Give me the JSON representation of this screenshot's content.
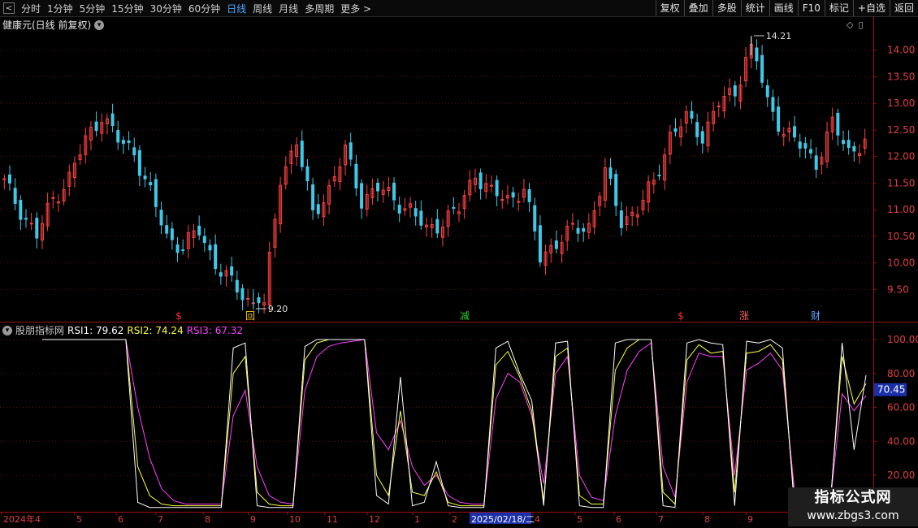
{
  "toolbar": {
    "back_glyph": "<",
    "periods": [
      "分时",
      "1分钟",
      "5分钟",
      "15分钟",
      "30分钟",
      "60分钟",
      "日线",
      "周线",
      "月线",
      "多周期",
      "更多 >"
    ],
    "active_period": "日线",
    "right_buttons": [
      "复权",
      "叠加",
      "多股",
      "统计",
      "画线",
      "F10",
      "标记",
      "+自选",
      "返回"
    ]
  },
  "main_panel": {
    "title": "健康元(日线 前复权)",
    "high_label": "14.21",
    "low_label": "9.20",
    "price_axis": [
      "14.00",
      "13.50",
      "13.00",
      "12.50",
      "12.00",
      "11.50",
      "11.00",
      "10.50",
      "10.00",
      "9.50"
    ],
    "event_markers": [
      {
        "glyph": "$",
        "color": "#ff3030"
      },
      {
        "glyph": "回",
        "color": "#ffcc00"
      },
      {
        "glyph": "减",
        "color": "#30d030"
      },
      {
        "glyph": "$",
        "color": "#ff3030"
      },
      {
        "glyph": "涨",
        "color": "#ff6060"
      },
      {
        "glyph": "财",
        "color": "#60a0ff"
      }
    ]
  },
  "indicator_panel": {
    "name": "股朋指标网",
    "rsi1": "RSI1: 79.62",
    "rsi2": "RSI2: 74.24",
    "rsi3": "RSI3: 67.32",
    "axis": [
      "100.00",
      "80.00",
      "60.00",
      "40.00",
      "20.00"
    ],
    "current_value": "70.45"
  },
  "date_axis": {
    "labels": [
      "2024年4",
      "5",
      "6",
      "7",
      "8",
      "9",
      "10",
      "11",
      "12",
      "1",
      "2",
      "2025/02/18/二",
      "4",
      "5",
      "6",
      "7",
      "8",
      "9"
    ],
    "highlight": "2025/02/18/二"
  },
  "watermark": {
    "line1": "指标公式网",
    "line2": "www.zbgs3.com"
  },
  "colors": {
    "up": "#ff4040",
    "down": "#40c8e8",
    "axis": "#a01010",
    "rsi1": "#ffffff",
    "rsi2": "#ffff40",
    "rsi3": "#ff40ff"
  },
  "chart_data": [
    {
      "type": "candlestick",
      "title": "健康元(日线 前复权)",
      "price_range": [
        9.2,
        14.21
      ],
      "close_trace": [
        [
          "2024-04",
          11.5
        ],
        [
          "2024-04",
          11.0
        ],
        [
          "2024-04",
          10.5
        ],
        [
          "2024-05",
          11.2
        ],
        [
          "2024-05",
          11.6
        ],
        [
          "2024-05",
          12.3
        ],
        [
          "2024-06",
          12.8
        ],
        [
          "2024-06",
          12.3
        ],
        [
          "2024-06",
          12.1
        ],
        [
          "2024-07",
          11.3
        ],
        [
          "2024-07",
          10.5
        ],
        [
          "2024-07",
          10.3
        ],
        [
          "2024-08",
          10.6
        ],
        [
          "2024-08",
          10.0
        ],
        [
          "2024-08",
          9.6
        ],
        [
          "2024-09",
          9.3
        ],
        [
          "2024-09",
          9.2
        ],
        [
          "2024-09",
          11.6
        ],
        [
          "2024-10",
          12.3
        ],
        [
          "2024-10",
          10.9
        ],
        [
          "2024-10",
          11.4
        ],
        [
          "2024-11",
          12.1
        ],
        [
          "2024-11",
          11.2
        ],
        [
          "2024-11",
          11.4
        ],
        [
          "2024-12",
          11.2
        ],
        [
          "2024-12",
          11.0
        ],
        [
          "2024-12",
          10.6
        ],
        [
          "2025-01",
          10.8
        ],
        [
          "2025-01",
          11.0
        ],
        [
          "2025-01",
          11.7
        ],
        [
          "2025-02",
          11.3
        ],
        [
          "2025-02",
          11.2
        ],
        [
          "2025-02",
          11.4
        ],
        [
          "2025-03",
          10.1
        ],
        [
          "2025-03",
          10.4
        ],
        [
          "2025-03",
          10.6
        ],
        [
          "2025-04",
          10.7
        ],
        [
          "2025-04",
          11.7
        ],
        [
          "2025-04",
          10.8
        ],
        [
          "2025-05",
          11.0
        ],
        [
          "2025-05",
          11.5
        ],
        [
          "2025-05",
          12.4
        ],
        [
          "2025-06",
          12.7
        ],
        [
          "2025-06",
          12.4
        ],
        [
          "2025-06",
          13.0
        ],
        [
          "2025-07",
          13.2
        ],
        [
          "2025-07",
          14.21
        ],
        [
          "2025-07",
          13.0
        ],
        [
          "2025-08",
          12.5
        ],
        [
          "2025-08",
          12.2
        ],
        [
          "2025-08",
          11.9
        ],
        [
          "2025-09",
          12.6
        ],
        [
          "2025-09",
          12.1
        ],
        [
          "2025-09",
          12.3
        ]
      ]
    },
    {
      "type": "line",
      "ylim": [
        20,
        100
      ],
      "series": [
        {
          "name": "RSI1",
          "color": "#ffffff",
          "values": [
            100,
            100,
            100,
            100,
            100,
            100,
            100,
            100,
            4,
            1,
            1,
            1,
            1,
            1,
            1,
            1,
            95,
            98,
            2,
            1,
            1,
            1,
            96,
            100,
            100,
            100,
            100,
            100,
            8,
            3,
            78,
            2,
            4,
            28,
            2,
            1,
            1,
            1,
            95,
            99,
            80,
            64,
            2,
            98,
            99,
            2,
            1,
            1,
            98,
            100,
            100,
            100,
            2,
            1,
            98,
            100,
            98,
            97,
            2,
            99,
            98,
            100,
            95,
            1,
            1,
            1,
            1,
            98,
            35,
            79
          ]
        },
        {
          "name": "RSI2",
          "color": "#ffff40",
          "values": [
            100,
            100,
            100,
            100,
            100,
            100,
            100,
            100,
            25,
            8,
            3,
            2,
            2,
            2,
            2,
            2,
            80,
            90,
            10,
            3,
            2,
            2,
            88,
            98,
            100,
            100,
            100,
            100,
            20,
            8,
            58,
            10,
            8,
            22,
            4,
            2,
            2,
            2,
            85,
            93,
            78,
            58,
            5,
            90,
            95,
            8,
            3,
            3,
            82,
            95,
            100,
            100,
            10,
            3,
            88,
            97,
            92,
            93,
            10,
            92,
            93,
            97,
            88,
            5,
            3,
            3,
            3,
            90,
            62,
            74
          ]
        },
        {
          "name": "RSI3",
          "color": "#ff40ff",
          "values": [
            100,
            100,
            100,
            100,
            100,
            100,
            100,
            100,
            60,
            30,
            12,
            5,
            3,
            3,
            3,
            3,
            55,
            70,
            25,
            8,
            4,
            3,
            70,
            90,
            96,
            98,
            99,
            100,
            45,
            35,
            52,
            25,
            14,
            20,
            8,
            4,
            3,
            3,
            65,
            80,
            75,
            55,
            15,
            80,
            90,
            20,
            7,
            5,
            55,
            82,
            93,
            98,
            25,
            7,
            75,
            92,
            90,
            90,
            20,
            82,
            86,
            92,
            82,
            12,
            5,
            4,
            4,
            68,
            58,
            67
          ]
        }
      ]
    }
  ]
}
